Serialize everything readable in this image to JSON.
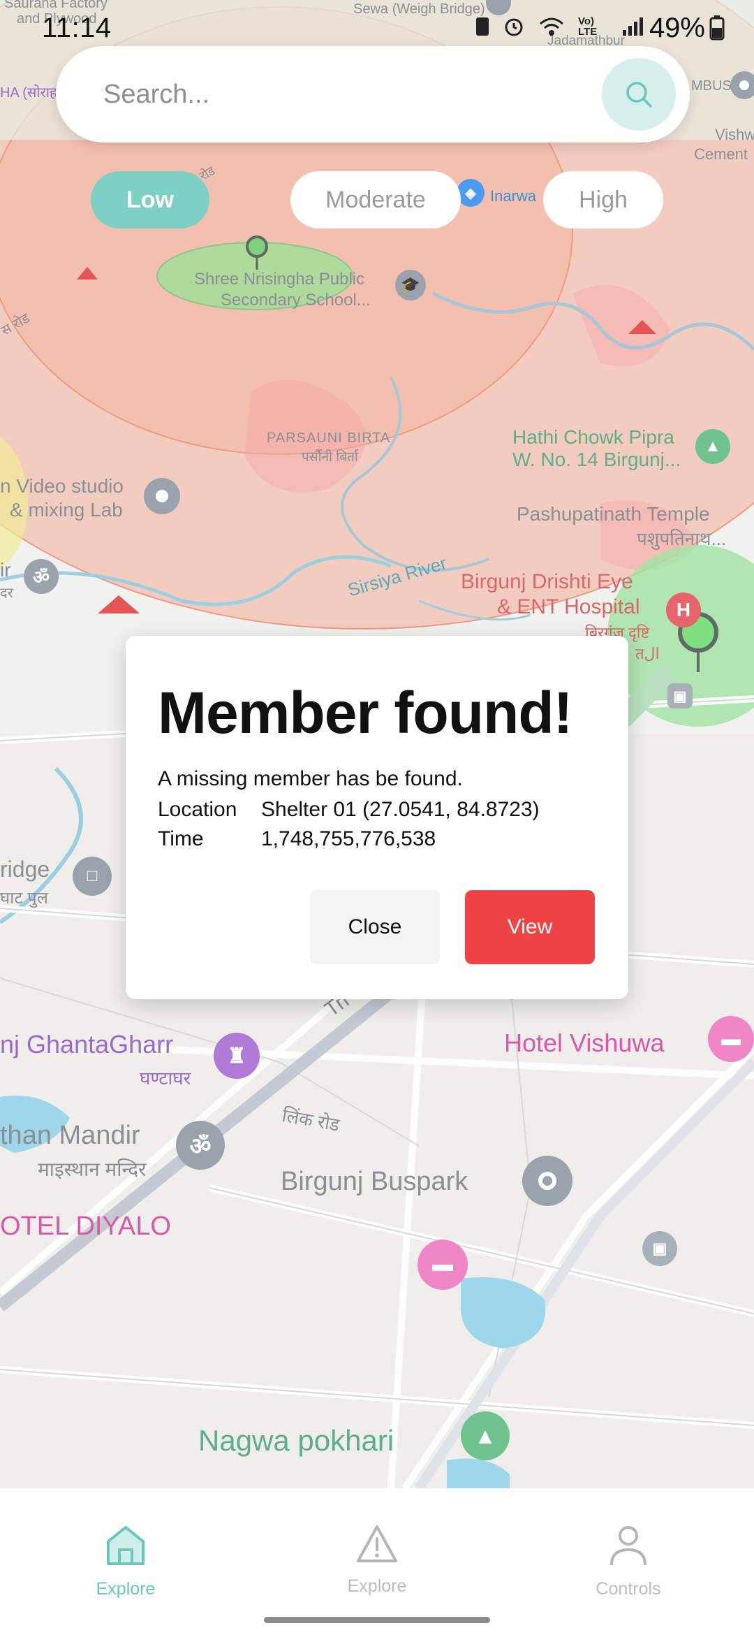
{
  "status_bar": {
    "time": "11:14",
    "battery": "49%",
    "network": "Vo) LTE"
  },
  "search": {
    "placeholder": "Search..."
  },
  "filters": {
    "low": "Low",
    "moderate": "Moderate",
    "high": "High"
  },
  "map": {
    "labels": {
      "sauraha_factory": "Sauraha Factory",
      "and_plywood": "and Plywood",
      "sewa_weigh_bridge": "Sewa (Weigh Bridge)",
      "jadamathbur": "Jadamathbur",
      "ha_sirha": "HA (सोराह",
      "mbus": "MBUS",
      "vishw": "Vishw",
      "cement": "Cement",
      "road_rod": "रोड",
      "inarwa": "Inarwa",
      "shree_school_1": "Shree Nrisingha Public",
      "shree_school_2": "Secondary School...",
      "road_left": "स रोड",
      "parsauni_birta": "PARSAUNI BIRTA",
      "parsauni_birta_np": "पर्सौनी बिर्ता",
      "hathi_chowk_1": "Hathi Chowk Pipra",
      "hathi_chowk_2": "W. No. 14 Birgunj...",
      "video_studio_1": "n Video studio",
      "video_studio_2": "& mixing Lab",
      "pashupatinath_1": "Pashupatinath Temple",
      "pashupatinath_2": "पशुपतिनाथ...",
      "ir": "ir",
      "dre": "दर",
      "sirsiya_river": "Sirsiya River",
      "birgunj_drishti_1": "Birgunj Drishti Eye",
      "birgunj_drishti_2": "& ENT Hospital",
      "birgunj_drishti_np1": "बिरगंज दृष्टि",
      "birgunj_drishti_np2": "तال",
      "bridge": "ridge",
      "bridge_np": "घाट पुल",
      "ghantagharr": "nj GhantaGharr",
      "ghantagharr_np": "घण्टाघर",
      "hotel_vishuwa": "Hotel Vishuwa",
      "tri": "Tri",
      "link_road": "लिंक रोड",
      "than_mandir": "than Mandir",
      "than_mandir_np": "माइस्थान मन्दिर",
      "birgunj_buspark": "Birgunj Buspark",
      "hotel_diyalo": "OTEL DIYALO",
      "nagwa_pokhari": "Nagwa pokhari"
    }
  },
  "dialog": {
    "title": "Member found!",
    "message": "A missing member has be found.",
    "location_label": "Location",
    "location_value": "Shelter 01 (27.0541, 84.8723)",
    "time_label": "Time",
    "time_value": "1,748,755,776,538",
    "close_label": "Close",
    "view_label": "View"
  },
  "bottom_nav": {
    "items": [
      {
        "label": "Explore",
        "icon": "home-icon",
        "active": true
      },
      {
        "label": "Explore",
        "icon": "warning-icon",
        "active": false
      },
      {
        "label": "Controls",
        "icon": "user-icon",
        "active": false
      }
    ]
  },
  "colors": {
    "accent": "#7dd0c4",
    "danger": "#ef4445",
    "zone_red": "#f4a9a0",
    "zone_green": "#a6e3a6"
  }
}
